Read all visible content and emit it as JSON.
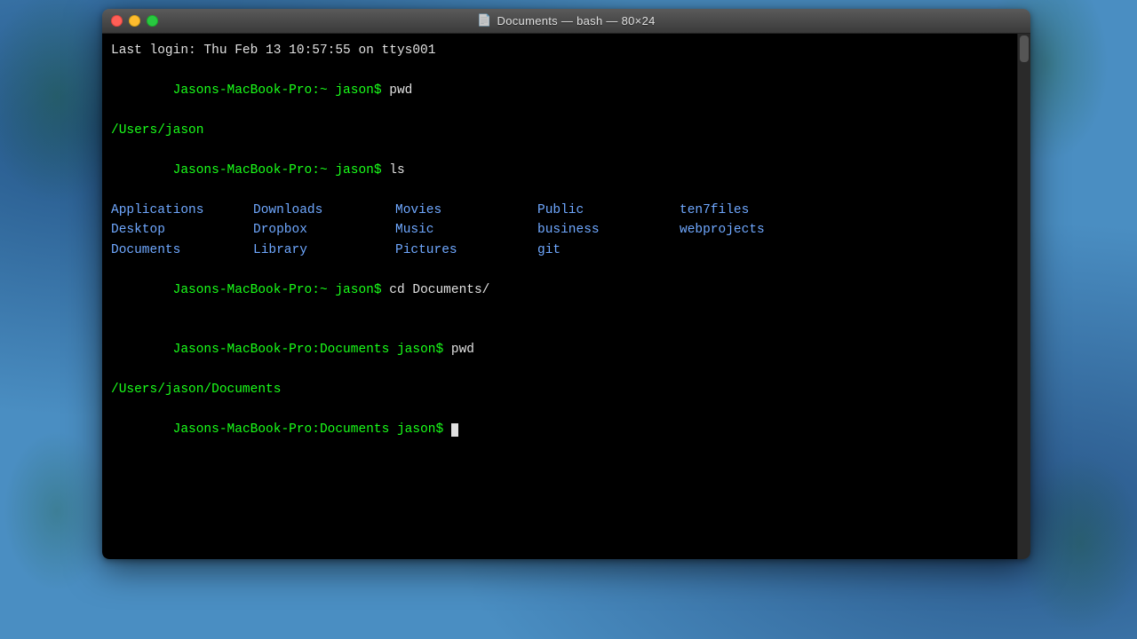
{
  "window": {
    "title": "Documents — bash — 80×24",
    "title_icon": "📄"
  },
  "controls": {
    "close_label": "close",
    "minimize_label": "minimize",
    "maximize_label": "maximize"
  },
  "terminal": {
    "last_login": "Last login: Thu Feb 13 10:57:55 on ttys001",
    "prompt1": "Jasons-MacBook-Pro:~ jason$ ",
    "cmd1": "pwd",
    "path1": "/Users/jason",
    "prompt2": "Jasons-MacBook-Pro:~ jason$ ",
    "cmd2": "ls",
    "ls_items": [
      "Applications",
      "Downloads",
      "Movies",
      "Public",
      "ten7files",
      "Desktop",
      "Dropbox",
      "Music",
      "business",
      "webprojects",
      "Documents",
      "Library",
      "Pictures",
      "git",
      ""
    ],
    "prompt3": "Jasons-MacBook-Pro:~ jason$ ",
    "cmd3": "cd Documents/",
    "prompt4": "Jasons-MacBook-Pro:Documents jason$ ",
    "cmd4": "pwd",
    "path2": "/Users/jason/Documents",
    "prompt5": "Jasons-MacBook-Pro:Documents jason$ "
  }
}
